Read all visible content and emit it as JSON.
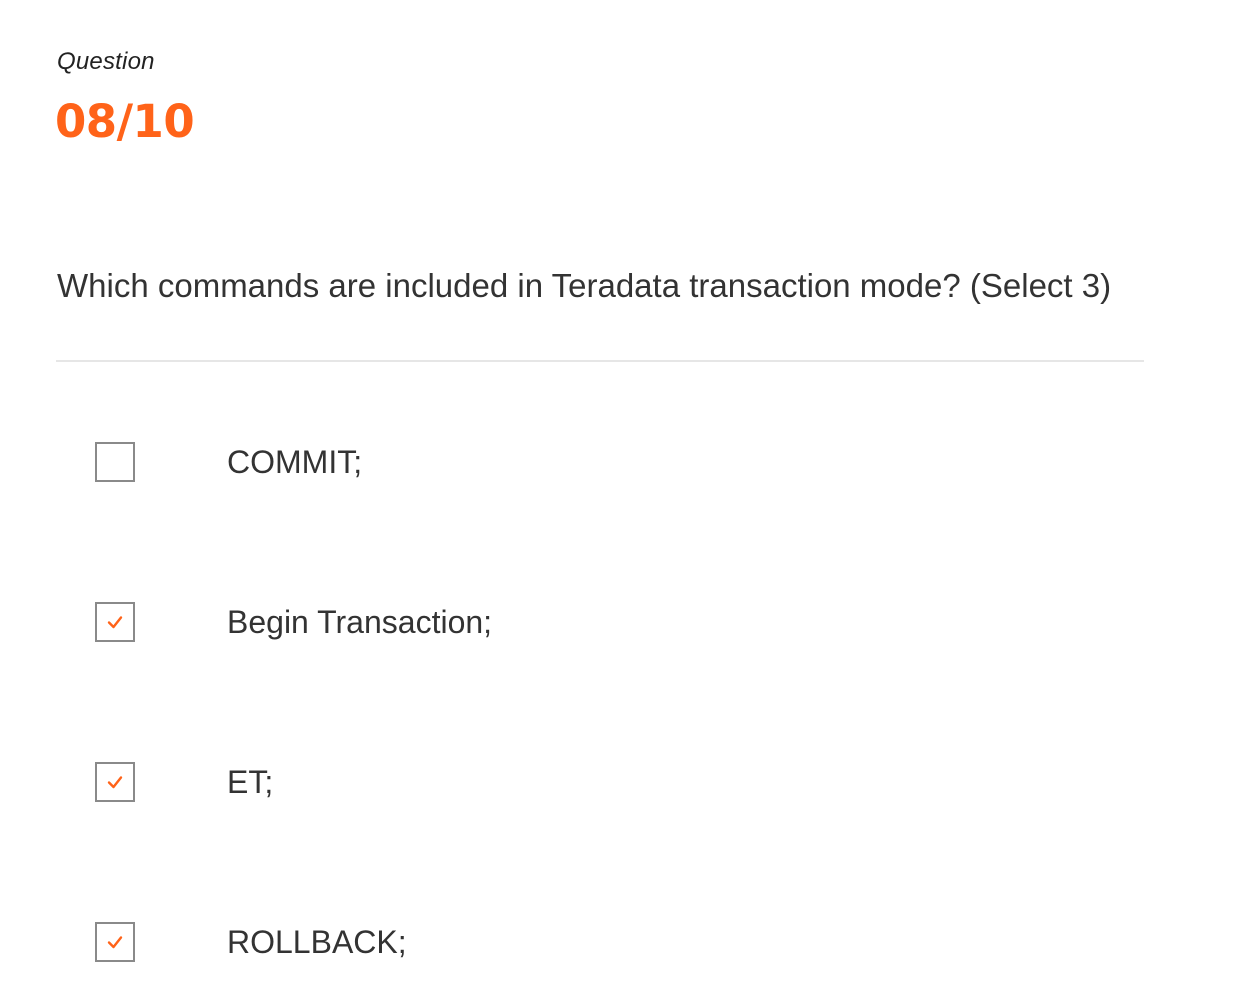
{
  "header": {
    "label": "Question",
    "counter": "08/10"
  },
  "question": {
    "text": "Which commands are included in Teradata transaction mode? (Select 3)"
  },
  "options": [
    {
      "label": "COMMIT;",
      "checked": false
    },
    {
      "label": "Begin Transaction;",
      "checked": true
    },
    {
      "label": "ET;",
      "checked": true
    },
    {
      "label": "ROLLBACK;",
      "checked": true
    }
  ],
  "colors": {
    "accent": "#ff6319",
    "text": "#333333",
    "checkbox_border": "#8a8a8a",
    "divider": "#e6e6e6"
  },
  "icons": {
    "checkmark": "check-icon"
  }
}
